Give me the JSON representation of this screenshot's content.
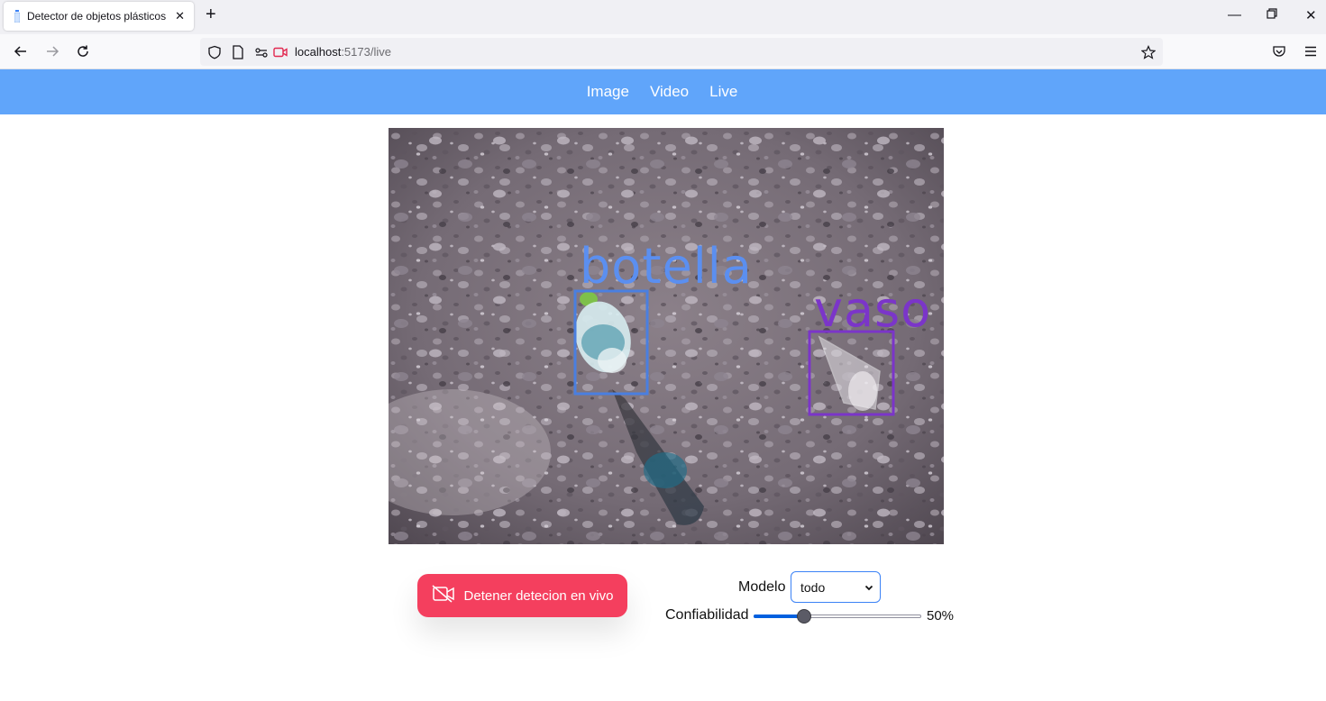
{
  "browser": {
    "tab_title": "Detector de objetos plásticos",
    "url_host": "localhost",
    "url_rest": ":5173/live"
  },
  "nav": {
    "links": [
      "Image",
      "Video",
      "Live"
    ]
  },
  "detections": [
    {
      "label": "botella",
      "color": "#4a7fe0"
    },
    {
      "label": "vaso",
      "color": "#7b35c9"
    }
  ],
  "controls": {
    "stop_button_label": "Detener detecion en vivo",
    "stop_button_icon": "video-off-icon",
    "model_label": "Modelo",
    "model_value": "todo",
    "confidence_label": "Confiabilidad",
    "confidence_value": 0.3,
    "confidence_text": "50%"
  },
  "colors": {
    "header": "#60a5fa",
    "stop_button": "#f43f5e",
    "slider_fill": "#0060df"
  }
}
